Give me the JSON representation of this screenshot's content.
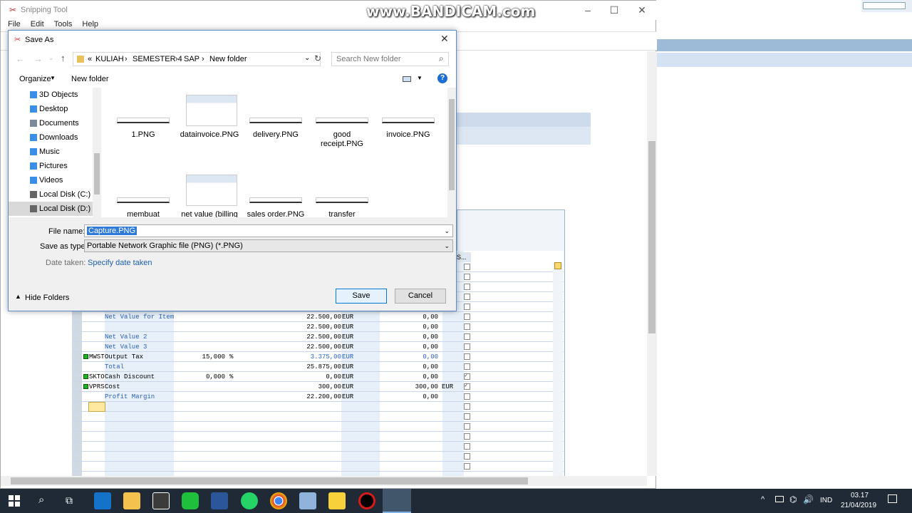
{
  "watermark": "www.BANDICAM.com",
  "snipping_tool": {
    "title": "Snipping Tool",
    "menu": [
      "File",
      "Edit",
      "Tools",
      "Help"
    ]
  },
  "sap_grid": {
    "rows": [
      {
        "code": "",
        "desc": "Net Value for Item",
        "amount": "",
        "pct": "",
        "value": "22.500,00",
        "cur": "EUR",
        "cond": "0,00",
        "cur2": "",
        "checked": false,
        "led": false,
        "blue": true
      },
      {
        "code": "",
        "desc": "",
        "amount": "",
        "pct": "",
        "value": "22.500,00",
        "cur": "EUR",
        "cond": "0,00",
        "cur2": "",
        "checked": false,
        "led": false,
        "blue": false
      },
      {
        "code": "",
        "desc": "Net Value 2",
        "amount": "",
        "pct": "",
        "value": "22.500,00",
        "cur": "EUR",
        "cond": "0,00",
        "cur2": "",
        "checked": false,
        "led": false,
        "blue": true
      },
      {
        "code": "",
        "desc": "Net Value 3",
        "amount": "",
        "pct": "",
        "value": "22.500,00",
        "cur": "EUR",
        "cond": "0,00",
        "cur2": "",
        "checked": false,
        "led": false,
        "blue": true
      },
      {
        "code": "MWST",
        "desc": "Output Tax",
        "amount": "15,000",
        "pct": "%",
        "value": "3.375,00",
        "cur": "EUR",
        "cond": "0,00",
        "cur2": "",
        "checked": false,
        "led": true,
        "blue": false,
        "valblue": true
      },
      {
        "code": "",
        "desc": "Total",
        "amount": "",
        "pct": "",
        "value": "25.875,00",
        "cur": "EUR",
        "cond": "0,00",
        "cur2": "",
        "checked": false,
        "led": false,
        "blue": true
      },
      {
        "code": "SKTO",
        "desc": "Cash Discount",
        "amount": "0,000",
        "pct": "%",
        "value": "0,00",
        "cur": "EUR",
        "cond": "0,00",
        "cur2": "",
        "checked": true,
        "led": true,
        "blue": false
      },
      {
        "code": "VPRS",
        "desc": "Cost",
        "amount": "",
        "pct": "",
        "value": "300,00",
        "cur": "EUR",
        "cond": "300,00",
        "cur2": "EUR",
        "checked": true,
        "led": true,
        "blue": false
      },
      {
        "code": "",
        "desc": "Profit Margin",
        "amount": "",
        "pct": "",
        "value": "22.200,00",
        "cur": "EUR",
        "cond": "0,00",
        "cur2": "",
        "checked": false,
        "led": false,
        "blue": true
      }
    ],
    "header_s": "S..."
  },
  "dialog": {
    "title": "Save As",
    "breadcrumb": [
      "«",
      "KULIAH",
      "SEMESTER 4",
      "SAP",
      "New folder"
    ],
    "search_placeholder": "Search New folder",
    "organize": "Organize",
    "new_folder": "New folder",
    "nav_items": [
      {
        "label": "3D Objects",
        "icon": "3d-objects-icon",
        "color": "#3a8ee6"
      },
      {
        "label": "Desktop",
        "icon": "desktop-icon",
        "color": "#3a8ee6"
      },
      {
        "label": "Documents",
        "icon": "documents-icon",
        "color": "#7a8a99"
      },
      {
        "label": "Downloads",
        "icon": "downloads-icon",
        "color": "#3a8ee6"
      },
      {
        "label": "Music",
        "icon": "music-icon",
        "color": "#3a8ee6"
      },
      {
        "label": "Pictures",
        "icon": "pictures-icon",
        "color": "#3a8ee6"
      },
      {
        "label": "Videos",
        "icon": "videos-icon",
        "color": "#3a8ee6"
      },
      {
        "label": "Local Disk (C:)",
        "icon": "drive-icon",
        "color": "#666"
      },
      {
        "label": "Local Disk (D:)",
        "icon": "drive-icon",
        "color": "#666"
      }
    ],
    "files": [
      {
        "name": "1.PNG",
        "thumb": "wide"
      },
      {
        "name": "datainvoice.PNG",
        "thumb": "screen"
      },
      {
        "name": "delivery.PNG",
        "thumb": "wide"
      },
      {
        "name": "good receipt.PNG",
        "thumb": "wide"
      },
      {
        "name": "invoice.PNG",
        "thumb": "wide"
      },
      {
        "name": "membuat",
        "thumb": "wide"
      },
      {
        "name": "net value (billing",
        "thumb": "screen"
      },
      {
        "name": "sales order.PNG",
        "thumb": "wide"
      },
      {
        "name": "transfer",
        "thumb": "wide"
      }
    ],
    "file_name_label": "File name:",
    "file_name_value": "Capture.PNG",
    "save_type_label": "Save as type:",
    "save_type_value": "Portable Network Graphic file (PNG) (*.PNG)",
    "date_label": "Date taken:",
    "date_value": "Specify date taken",
    "hide_folders": "Hide Folders",
    "save": "Save",
    "cancel": "Cancel"
  },
  "taskbar": {
    "lang": "IND",
    "time": "03.17",
    "date": "21/04/2019"
  }
}
